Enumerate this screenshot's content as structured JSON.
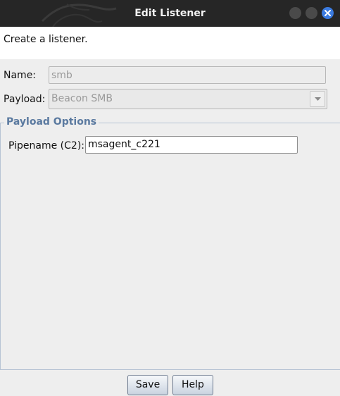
{
  "window": {
    "title": "Edit Listener",
    "close_color": "#3b7be0"
  },
  "description": "Create a listener.",
  "form": {
    "name_label": "Name:",
    "name_value": "smb",
    "payload_label": "Payload:",
    "payload_value": "Beacon SMB"
  },
  "payload_options": {
    "group_title": "Payload Options",
    "pipename_label": "Pipename (C2):",
    "pipename_value": "msagent_c221"
  },
  "buttons": {
    "save": "Save",
    "help": "Help"
  },
  "icons": [
    "kali-dragon-icon",
    "minimize-icon",
    "maximize-icon",
    "close-icon",
    "chevron-down-icon"
  ]
}
